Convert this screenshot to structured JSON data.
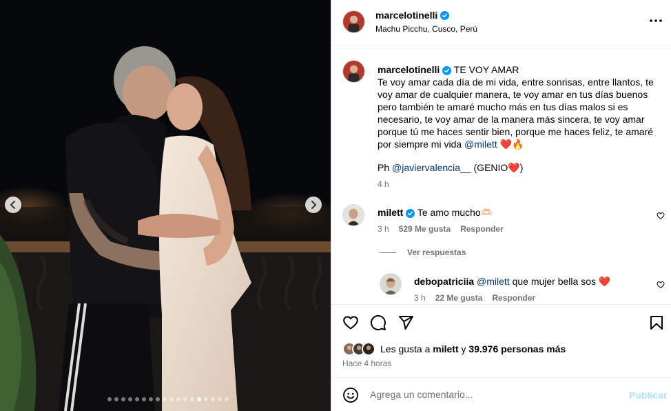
{
  "post": {
    "username": "marcelotinelli",
    "location": "Machu Picchu, Cusco, Perú",
    "more_icon": "more-horizontal-icon"
  },
  "caption": {
    "username": "marcelotinelli",
    "title": "TE VOY AMAR",
    "body": "Te voy amar cada día de mi vida, entre sonrisas, entre llantos, te voy amar de cualquier manera, te voy amar en tus días buenos pero también te amaré mucho más en tus días malos si es necesario, te voy amar de la manera más sincera, te voy amar porque tú me haces sentir bien, porque me haces feliz, te amaré por siempre mi vida",
    "mention": "@milett",
    "emojis": "❤️🔥",
    "ph_prefix": "Ph",
    "ph_mention": "@javiervalencia__",
    "ph_suffix": "(GENIO❤️)",
    "time": "4 h"
  },
  "comments": [
    {
      "username": "milett",
      "text": "Te amo mucho🫶🏻",
      "time": "3 h",
      "likes": "529 Me gusta",
      "reply": "Responder"
    }
  ],
  "view_replies": "Ver respuestas",
  "replies": [
    {
      "username": "debopatriciia",
      "mention": "@milett",
      "text": "que mujer bella sos ❤️",
      "time": "3 h",
      "likes": "22 Me gusta",
      "reply": "Responder"
    }
  ],
  "likes": {
    "prefix": "Les gusta a",
    "user": "milett",
    "joiner": "y",
    "count": "39.976 personas más"
  },
  "posted_ago": "Hace 4 horas",
  "add_comment": {
    "placeholder": "Agrega un comentario...",
    "publish_label": "Publicar"
  },
  "carousel": {
    "total": 18,
    "active_index": 13
  },
  "colors": {
    "verified": "#0095f6",
    "link": "#00376b",
    "secondary": "#737373",
    "publish_disabled": "#b2dffc"
  }
}
